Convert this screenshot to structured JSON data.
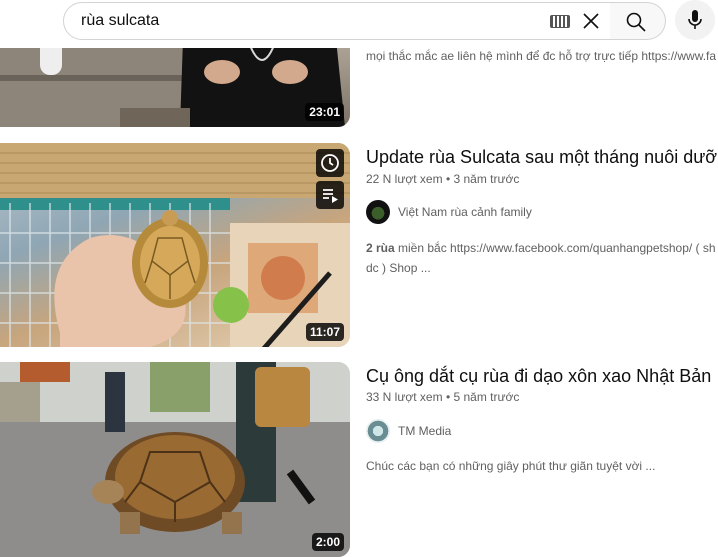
{
  "search": {
    "query": "rùa sulcata"
  },
  "icons": {
    "keyboard": "keyboard-icon",
    "clear": "close-icon",
    "search": "search-icon",
    "mic": "microphone-icon",
    "watch_later": "clock-icon",
    "add_to_queue": "playlist-add-icon"
  },
  "results": [
    {
      "duration": "23:01",
      "description": "mọi thắc mắc ae liên hệ mình để đc hỗ trợ trực tiếp https://www.fa"
    },
    {
      "title": "Update rùa Sulcata sau một tháng nuôi dưỡng",
      "views": "22 N lượt xem",
      "age": "3 năm trước",
      "channel": "Việt Nam rùa cảnh family",
      "description_line1_bold": "2 rùa",
      "description_line1_rest": " miền bắc https://www.facebook.com/quanhangpetshop/ ( sh",
      "description_line2": "dc ) Shop ...",
      "duration": "11:07"
    },
    {
      "title": "Cụ ông dắt cụ rùa đi dạo xôn xao Nhật Bản",
      "views": "33 N lượt xem",
      "age": "5 năm trước",
      "channel": "TM Media",
      "description": "Chúc các bạn có những giây phút thư giãn tuyệt vời ...",
      "duration": "2:00"
    }
  ]
}
